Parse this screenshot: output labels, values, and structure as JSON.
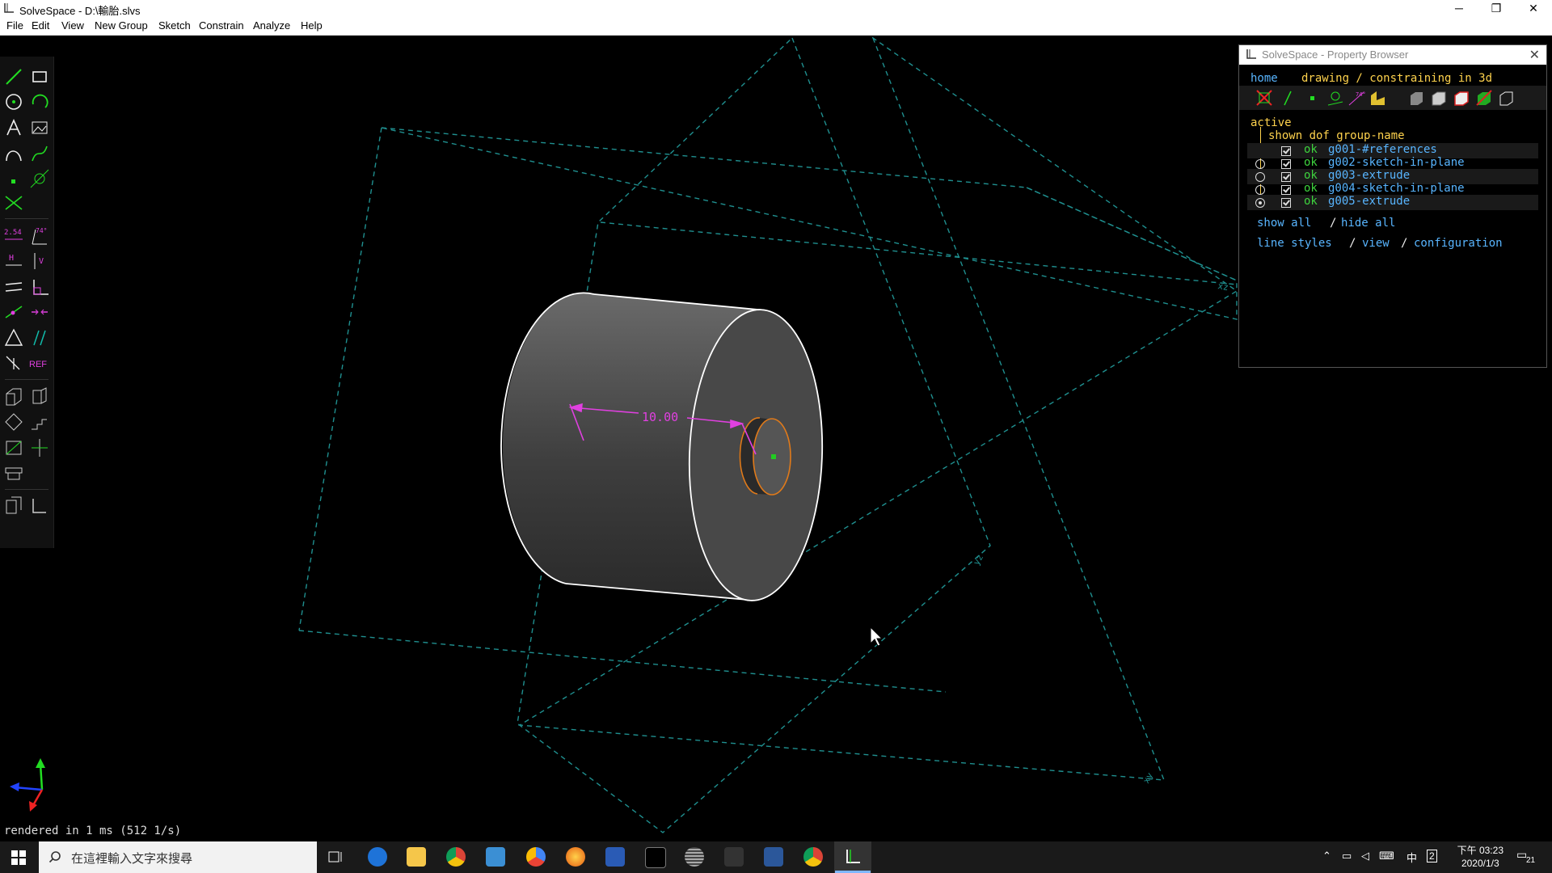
{
  "window": {
    "title": "SolveSpace - D:\\輸胎.slvs",
    "minimize": "─",
    "restore": "❐",
    "close": "✕"
  },
  "menu": [
    "File",
    "Edit",
    "View",
    "New Group",
    "Sketch",
    "Constrain",
    "Analyze",
    "Help"
  ],
  "toolbar": {
    "dimension_label": "2.54",
    "angle_label": "74°",
    "ref_label": "REF"
  },
  "model": {
    "dimension_value": "10.00",
    "plane_labels": [
      "xz",
      "yz",
      "xy"
    ]
  },
  "property_browser": {
    "title": "SolveSpace - Property Browser",
    "nav_home": "home",
    "nav_mode": "drawing / constraining in 3d",
    "active_label": "active",
    "header": "shown dof group-name",
    "groups": [
      {
        "dof": "ok",
        "name": "g001-#references",
        "radio": false,
        "selected": false
      },
      {
        "dof": "ok",
        "name": "g002-sketch-in-plane",
        "radio": true,
        "selected": false
      },
      {
        "dof": "ok",
        "name": "g003-extrude",
        "radio": true,
        "selected": false
      },
      {
        "dof": "ok",
        "name": "g004-sketch-in-plane",
        "radio": true,
        "selected": false
      },
      {
        "dof": "ok",
        "name": "g005-extrude",
        "radio": true,
        "selected": true
      }
    ],
    "show_all": "show all",
    "hide_all": "hide all",
    "slash": "/",
    "line_styles": "line styles",
    "view": "view",
    "configuration": "configuration"
  },
  "status": "rendered in 1 ms (512 1/s)",
  "taskbar": {
    "search_placeholder": "在這裡輸入文字來搜尋",
    "time": "下午 03:23",
    "date": "2020/1/3",
    "ime": "中",
    "notifications": "21"
  },
  "colors": {
    "accent_link": "#58b5ff",
    "dimension_magenta": "#e040e0",
    "plane_cyan": "#1f8f8f",
    "ok_green": "#3ed33e",
    "label_gold": "#ffd34d"
  }
}
